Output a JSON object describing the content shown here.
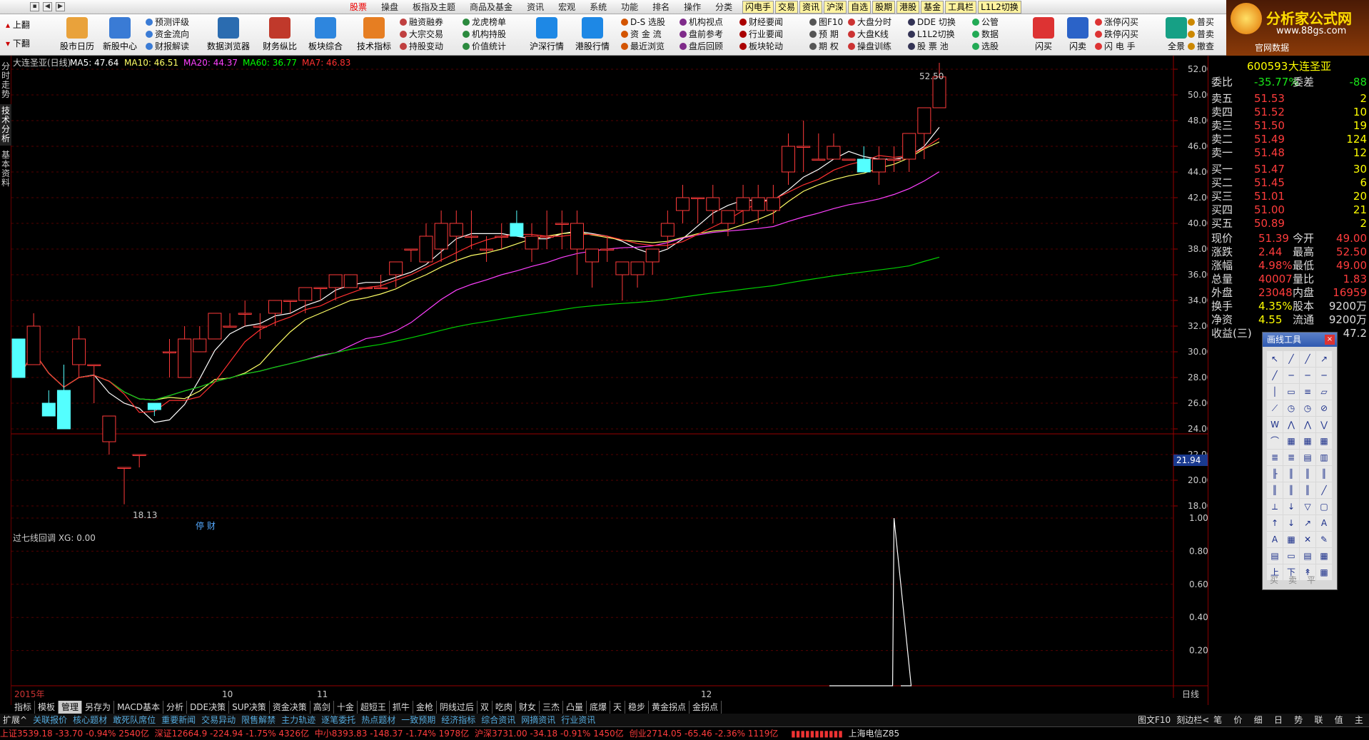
{
  "window": {
    "menu": [
      "股票",
      "操盘",
      "板指及主题",
      "商品及基金",
      "资讯",
      "宏观",
      "系统",
      "功能",
      "排名",
      "操作",
      "分类"
    ],
    "active_menu": "股票"
  },
  "quickbar": [
    "闪电手",
    "交易",
    "资讯",
    "沪深",
    "自选",
    "股期",
    "港股",
    "基金",
    "工具栏",
    "L1L2切换"
  ],
  "toolbar": {
    "page_up": "上翻",
    "page_down": "下翻",
    "big_buttons": [
      "股市日历",
      "新股中心",
      "数据浏览器",
      "财务纵比",
      "板块综合",
      "技术指标",
      "沪深行情",
      "港股行情",
      "闪买",
      "闪卖",
      "全景"
    ],
    "col1": [
      "预测评级",
      "资金流向",
      "财报解读"
    ],
    "col2": [
      "融资融券",
      "大宗交易",
      "持股变动"
    ],
    "col3": [
      "龙虎榜单",
      "机构持股",
      "价值统计"
    ],
    "col4": [
      "D-S 选股",
      "资 金 流",
      "最近浏览"
    ],
    "col5": [
      "机构视点",
      "盘前参考",
      "盘后回顾"
    ],
    "col6": [
      "财经要闻",
      "行业要闻",
      "板块轮动"
    ],
    "col7": [
      "图F10",
      "预 期",
      "期 权"
    ],
    "col8": [
      "大盘分时",
      "大盘K线",
      "操盘训练"
    ],
    "col9": [
      "DDE 切换",
      "L1L2切换",
      "股 票 池"
    ],
    "col10": [
      "公管",
      "数据",
      "选股"
    ],
    "col11": [
      "涨停闪买",
      "跌停闪买",
      "闪 电 手"
    ],
    "col12": [
      "普买",
      "普卖",
      "撤查"
    ]
  },
  "logo": {
    "text": "分析家公式网",
    "url": "www.88gs.com",
    "sub": "官网数据"
  },
  "left_tabs": [
    "分时走势",
    "技术分析",
    "基本资料"
  ],
  "chart": {
    "title": "大连圣亚(日线)",
    "ma": [
      {
        "label": "MA5: 47.64",
        "color": "#ffffff"
      },
      {
        "label": "MA10: 46.51",
        "color": "#ffff66"
      },
      {
        "label": "MA20: 44.37",
        "color": "#ff40ff"
      },
      {
        "label": "MA60: 36.77",
        "color": "#00ff00"
      },
      {
        "label": "MA7: 46.83",
        "color": "#ff3030"
      }
    ],
    "high_label": "52.50",
    "low_label": "18.13",
    "cursor_price": "21.94",
    "event_label": "停 财",
    "indicator_title": "过七线回调  XG: 0.00",
    "year_label": "2015年",
    "month_labels": [
      "10",
      "11",
      "12"
    ],
    "period": "日线"
  },
  "chart_data": {
    "type": "candlestick",
    "y_ticks": [
      18,
      20,
      22,
      24,
      26,
      28,
      30,
      32,
      34,
      36,
      38,
      40,
      42,
      44,
      46,
      48,
      50,
      52
    ],
    "indicator_ticks": [
      0.2,
      0.4,
      0.6,
      0.8,
      1.0
    ],
    "candles": [
      [
        31,
        33,
        28,
        30
      ],
      [
        29,
        31,
        32,
        33
      ],
      [
        26,
        28,
        25,
        27
      ],
      [
        27,
        30,
        24,
        29
      ],
      [
        29,
        28,
        31,
        32
      ],
      [
        29,
        26,
        29,
        27
      ],
      [
        23,
        22,
        25,
        23
      ],
      [
        21,
        18.13,
        21,
        21
      ],
      [
        22,
        21,
        22,
        21
      ],
      [
        26,
        25,
        25.5,
        26
      ],
      [
        30,
        28,
        30,
        31
      ],
      [
        28,
        30,
        31,
        32
      ],
      [
        30,
        31,
        31,
        32
      ],
      [
        31,
        31,
        33,
        32
      ],
      [
        32,
        33,
        32,
        33
      ],
      [
        33,
        32,
        33,
        34
      ],
      [
        32,
        31,
        32,
        33
      ],
      [
        33,
        32,
        34,
        34
      ],
      [
        34,
        33,
        34,
        34
      ],
      [
        34,
        33,
        35,
        35
      ],
      [
        35,
        34,
        35,
        35
      ],
      [
        35,
        34,
        36,
        36
      ],
      [
        35,
        35,
        36,
        36
      ],
      [
        35,
        35,
        35,
        35
      ],
      [
        35,
        35,
        35,
        36
      ],
      [
        36,
        35,
        37,
        37
      ],
      [
        38,
        37,
        38,
        38
      ],
      [
        37,
        37,
        39,
        40
      ],
      [
        38,
        37,
        40,
        41
      ],
      [
        39,
        37,
        40,
        41
      ],
      [
        39,
        38,
        39,
        41
      ],
      [
        38,
        37,
        38,
        39
      ],
      [
        39,
        38,
        39,
        40
      ],
      [
        40,
        39,
        39,
        41
      ],
      [
        38,
        37,
        39,
        40
      ],
      [
        39,
        38,
        39,
        41
      ],
      [
        40,
        38,
        40,
        41
      ],
      [
        38,
        36,
        40,
        41
      ],
      [
        37,
        35,
        38,
        38
      ],
      [
        38,
        37,
        38,
        39
      ],
      [
        36,
        34,
        37,
        37
      ],
      [
        36,
        35,
        37,
        37
      ],
      [
        37,
        36,
        38,
        38
      ],
      [
        39,
        38,
        40,
        41
      ],
      [
        41,
        40,
        42,
        43
      ],
      [
        42,
        40,
        42,
        42
      ],
      [
        41,
        40,
        42,
        43
      ],
      [
        40,
        39,
        41,
        41
      ],
      [
        41,
        40,
        42,
        43
      ],
      [
        41,
        40,
        42,
        43
      ],
      [
        41,
        40,
        42,
        43
      ],
      [
        44,
        43,
        46,
        47
      ],
      [
        46,
        44,
        46,
        48
      ],
      [
        45,
        45,
        45,
        47
      ],
      [
        45,
        45,
        46,
        47
      ],
      [
        45,
        45,
        45,
        45
      ],
      [
        45,
        44,
        44,
        46
      ],
      [
        44,
        43,
        45,
        46
      ],
      [
        45,
        44,
        45,
        46
      ],
      [
        45,
        44,
        47,
        47
      ],
      [
        47,
        45,
        49,
        49
      ],
      [
        49,
        49,
        51.4,
        52.5
      ]
    ],
    "signal_index": 58
  },
  "quote": {
    "code": "600593",
    "name": "大连圣亚",
    "wei_bi_label": "委比",
    "wei_bi": "-35.77%",
    "wei_cha_label": "委差",
    "wei_cha": "-88",
    "sell": [
      {
        "l": "卖五",
        "p": "51.53",
        "v": "2"
      },
      {
        "l": "卖四",
        "p": "51.52",
        "v": "10"
      },
      {
        "l": "卖三",
        "p": "51.50",
        "v": "19"
      },
      {
        "l": "卖二",
        "p": "51.49",
        "v": "124"
      },
      {
        "l": "卖一",
        "p": "51.48",
        "v": "12"
      }
    ],
    "buy": [
      {
        "l": "买一",
        "p": "51.47",
        "v": "30"
      },
      {
        "l": "买二",
        "p": "51.45",
        "v": "6"
      },
      {
        "l": "买三",
        "p": "51.01",
        "v": "20"
      },
      {
        "l": "买四",
        "p": "51.00",
        "v": "21"
      },
      {
        "l": "买五",
        "p": "50.89",
        "v": "2"
      }
    ],
    "stats": [
      [
        "现价",
        "51.39",
        "今开",
        "49.00"
      ],
      [
        "涨跌",
        "2.44",
        "最高",
        "52.50"
      ],
      [
        "涨幅",
        "4.98%",
        "最低",
        "49.00"
      ],
      [
        "总量",
        "40007",
        "量比",
        "1.83"
      ],
      [
        "外盘",
        "23048",
        "内盘",
        "16959"
      ],
      [
        "换手",
        "4.35%",
        "股本",
        "9200万"
      ],
      [
        "净资",
        "4.55",
        "流通",
        "9200万"
      ],
      [
        "收益(三)",
        "",
        "",
        "47.2"
      ]
    ]
  },
  "draw_tools": {
    "title": "画线工具",
    "close": "×",
    "buttons": [
      "买",
      "卖",
      "平"
    ]
  },
  "formula_tabs": [
    "指标",
    "模板",
    "管理",
    "另存为",
    "MACD基本",
    "分析",
    "DDE决策",
    "SUP决策",
    "资金决策",
    "高剑",
    "十金",
    "超短王",
    "抓牛",
    "金枪",
    "阴线过后",
    "双",
    "吃肉",
    "财女",
    "三杰",
    "凸量",
    "底爆",
    "天",
    "稳步",
    "黄金拐点",
    "金拐点"
  ],
  "ext_tabs": [
    "扩展^",
    "关联报价",
    "核心题材",
    "敢死队席位",
    "重要新闻",
    "交易异动",
    "限售解禁",
    "主力轨迹",
    "逐笔委托",
    "热点题材",
    "一致预期",
    "经济指标",
    "综合资讯",
    "网摘资讯",
    "行业资讯"
  ],
  "bottom_right": [
    "图文F10",
    "刻边栏<"
  ],
  "right_tabs": [
    "笔",
    "价",
    "细",
    "日",
    "势",
    "联",
    "值",
    "主"
  ],
  "status": {
    "sh": "上证3539.18  -33.70  -0.94%  2540亿",
    "sz": "深证12664.9  -224.94  -1.75%  4326亿",
    "zx": "中小8393.83  -148.37  -1.74%  1978亿",
    "hs": "沪深3731.00  -34.18  -0.91%  1450亿",
    "cy": "创业2714.05  -65.46  -2.36%  1119亿",
    "net": "上海电信Z85"
  }
}
